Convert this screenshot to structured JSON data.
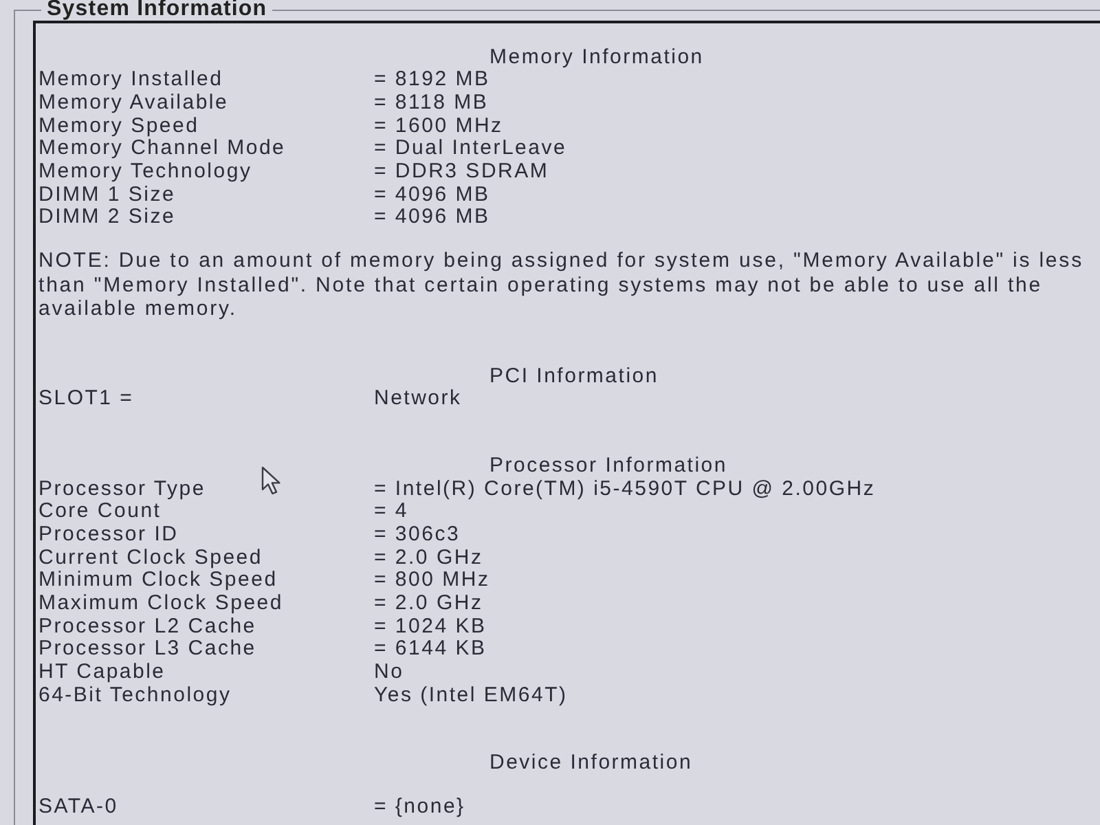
{
  "group_box": {
    "title": "System Information"
  },
  "sections": [
    {
      "heading": "Memory Information",
      "rows": [
        {
          "label": "Memory Installed",
          "value": "= 8192 MB"
        },
        {
          "label": "Memory Available",
          "value": "= 8118 MB"
        },
        {
          "label": "Memory Speed",
          "value": "= 1600 MHz"
        },
        {
          "label": "Memory Channel Mode",
          "value": "= Dual InterLeave"
        },
        {
          "label": "Memory Technology",
          "value": "= DDR3 SDRAM"
        },
        {
          "label": "DIMM 1 Size",
          "value": "= 4096 MB"
        },
        {
          "label": "DIMM 2 Size",
          "value": "= 4096 MB"
        }
      ],
      "note": "NOTE: Due to an amount of memory being assigned for system use, \"Memory Available\" is less than \"Memory Installed\". Note that certain operating systems may not be able to use all the available memory."
    },
    {
      "heading": "PCI Information",
      "rows": [
        {
          "label": "SLOT1 =",
          "value": "Network"
        }
      ]
    },
    {
      "heading": "Processor Information",
      "rows": [
        {
          "label": "Processor Type",
          "value": "= Intel(R) Core(TM) i5-4590T CPU @ 2.00GHz"
        },
        {
          "label": "Core Count",
          "value": "= 4"
        },
        {
          "label": "Processor ID",
          "value": "= 306c3"
        },
        {
          "label": "Current Clock Speed",
          "value": "= 2.0 GHz"
        },
        {
          "label": "Minimum Clock Speed",
          "value": "= 800 MHz"
        },
        {
          "label": "Maximum Clock Speed",
          "value": "= 2.0 GHz"
        },
        {
          "label": "Processor L2 Cache",
          "value": "= 1024 KB"
        },
        {
          "label": "Processor L3 Cache",
          "value": "= 6144 KB"
        },
        {
          "label": "HT Capable",
          "value": "No"
        },
        {
          "label": "64-Bit Technology",
          "value": "Yes (Intel EM64T)"
        }
      ]
    },
    {
      "heading": "Device Information",
      "rows": [
        {
          "label": "SATA-0",
          "value": "= {none}"
        }
      ]
    }
  ]
}
